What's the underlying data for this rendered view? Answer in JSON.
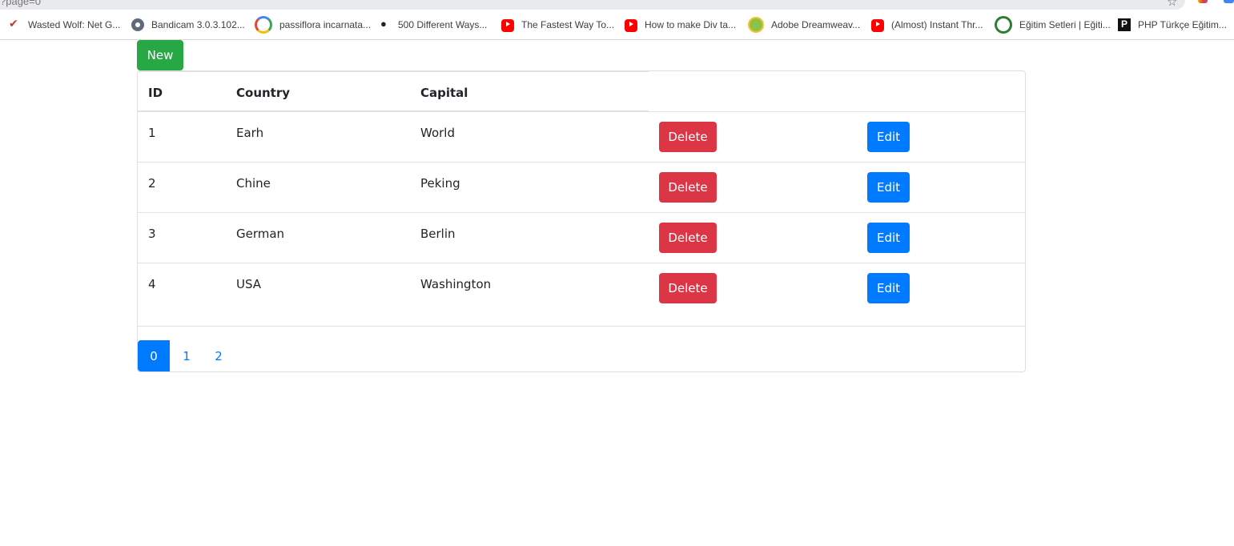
{
  "browser": {
    "url_fragment": "?page=0",
    "bookmarks": [
      {
        "label": "Wasted Wolf: Net G...",
        "icon": "wolf-icon"
      },
      {
        "label": "Bandicam 3.0.3.102...",
        "icon": "gear-icon"
      },
      {
        "label": "passiflora incarnata...",
        "icon": "google-icon"
      },
      {
        "label": "500 Different Ways...",
        "icon": "bee-icon"
      },
      {
        "label": "The Fastest Way To...",
        "icon": "youtube-icon"
      },
      {
        "label": "How to make Div ta...",
        "icon": "youtube-icon"
      },
      {
        "label": "Adobe Dreamweav...",
        "icon": "dreamweaver-icon"
      },
      {
        "label": "(Almost) Instant Thr...",
        "icon": "youtube-icon"
      },
      {
        "label": "Eğitim Setleri | Eğiti...",
        "icon": "egitim-icon"
      },
      {
        "label": "PHP Türkçe Eğitim...",
        "icon": "php-icon"
      }
    ]
  },
  "toolbar": {
    "new_label": "New"
  },
  "table": {
    "headers": {
      "id": "ID",
      "country": "Country",
      "capital": "Capital"
    },
    "rows": [
      {
        "id": "1",
        "country": "Earh",
        "capital": "World",
        "delete": "Delete",
        "edit": "Edit"
      },
      {
        "id": "2",
        "country": "Chine",
        "capital": "Peking",
        "delete": "Delete",
        "edit": "Edit"
      },
      {
        "id": "3",
        "country": "German",
        "capital": "Berlin",
        "delete": "Delete",
        "edit": "Edit"
      },
      {
        "id": "4",
        "country": "USA",
        "capital": "Washington",
        "delete": "Delete",
        "edit": "Edit"
      }
    ]
  },
  "pagination": {
    "pages": [
      "0",
      "1",
      "2"
    ],
    "active": "0"
  },
  "colors": {
    "new": "#28a745",
    "delete": "#dc3545",
    "edit": "#007bff"
  }
}
